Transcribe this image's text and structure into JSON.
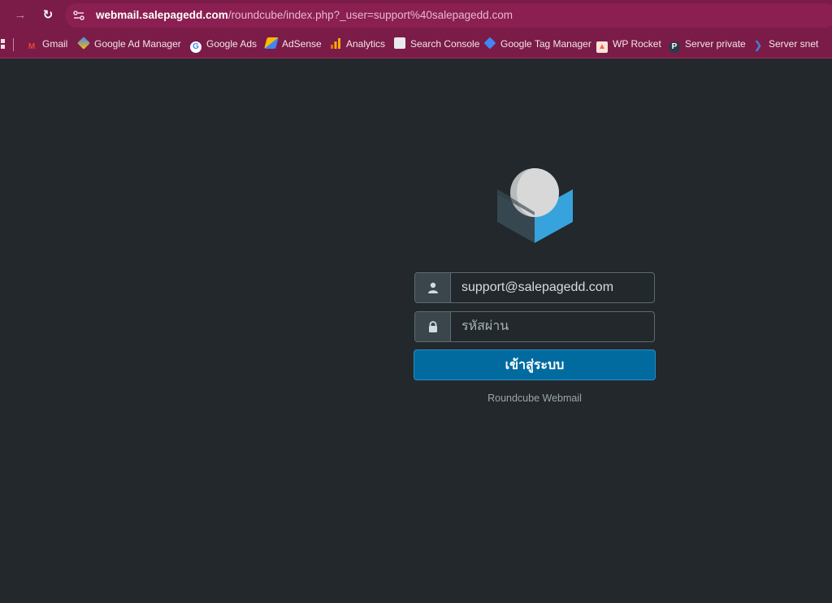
{
  "browser": {
    "url_host": "webmail.salepagedd.com",
    "url_path": "/roundcube/index.php?_user=support%40salepagedd.com",
    "bookmarks": [
      {
        "label": "Gmail",
        "icon": "gmail-icon",
        "color": "#ea4335"
      },
      {
        "label": "Google Ad Manager",
        "icon": "ad-manager-icon",
        "color": "#fbbc04"
      },
      {
        "label": "Google Ads",
        "icon": "google-icon",
        "color": "#ffffff"
      },
      {
        "label": "AdSense",
        "icon": "adsense-icon",
        "color": "#fbbc04"
      },
      {
        "label": "Analytics",
        "icon": "analytics-icon",
        "color": "#f9ab00"
      },
      {
        "label": "Search Console",
        "icon": "search-console-icon",
        "color": "#4285f4"
      },
      {
        "label": "Google Tag Manager",
        "icon": "tag-manager-icon",
        "color": "#4285f4"
      },
      {
        "label": "WP Rocket",
        "icon": "wp-rocket-icon",
        "color": "#f56640"
      },
      {
        "label": "Server private",
        "icon": "server-private-icon",
        "color": "#2b3a4a"
      },
      {
        "label": "Server snet",
        "icon": "server-snet-icon",
        "color": "#4a7fd4"
      }
    ]
  },
  "login": {
    "username_value": "support@salepagedd.com",
    "password_placeholder": "รหัสผ่าน",
    "submit_label": "เข้าสู่ระบบ",
    "footer": "Roundcube Webmail"
  },
  "colors": {
    "browser_accent": "#7a1c47",
    "page_bg": "#22282b",
    "button": "#016b9f",
    "logo_blue": "#37a3dd",
    "logo_dark": "#37474f"
  }
}
